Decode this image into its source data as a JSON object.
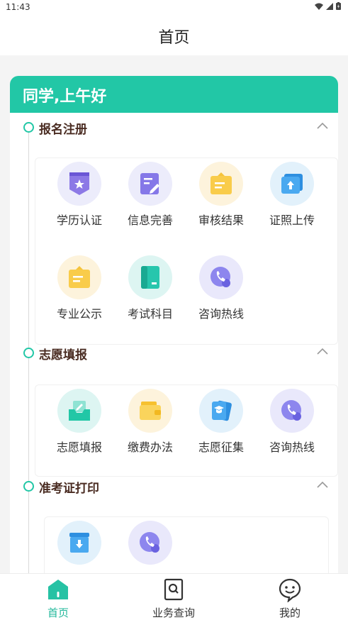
{
  "status_bar": {
    "time": "11:43"
  },
  "header": {
    "title": "首页"
  },
  "greeting": "同学,上午好",
  "sections": [
    {
      "title": "报名注册",
      "items": [
        "学历认证",
        "信息完善",
        "审核结果",
        "证照上传",
        "专业公示",
        "考试科目",
        "咨询热线"
      ]
    },
    {
      "title": "志愿填报",
      "items": [
        "志愿填报",
        "缴费办法",
        "志愿征集",
        "咨询热线"
      ]
    },
    {
      "title": "准考证打印",
      "items": [
        "",
        ""
      ]
    }
  ],
  "tabs": [
    {
      "label": "首页",
      "active": true
    },
    {
      "label": "业务查询",
      "active": false
    },
    {
      "label": "我的",
      "active": false
    }
  ],
  "colors": {
    "accent": "#22c7a6",
    "section_title": "#4a2c22"
  }
}
